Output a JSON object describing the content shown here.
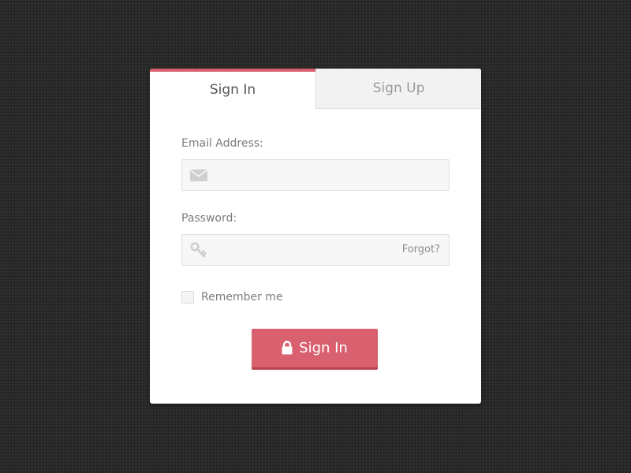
{
  "tabs": {
    "sign_in": "Sign In",
    "sign_up": "Sign Up"
  },
  "form": {
    "email_label": "Email Address:",
    "email_value": "",
    "email_placeholder": "",
    "password_label": "Password:",
    "password_value": "",
    "password_placeholder": "",
    "forgot_link": "Forgot?",
    "remember_label": "Remember me",
    "remember_checked": false,
    "submit_label": "Sign In"
  },
  "icons": {
    "email": "envelope-icon",
    "password": "key-icon",
    "submit": "lock-icon"
  },
  "colors": {
    "accent": "#d9606f",
    "accent_dark": "#b8404f",
    "background": "#2a2a2a",
    "card": "#ffffff",
    "input_bg": "#f7f7f7",
    "inactive_tab": "#f2f2f2",
    "label_text": "#7b7b7b"
  }
}
